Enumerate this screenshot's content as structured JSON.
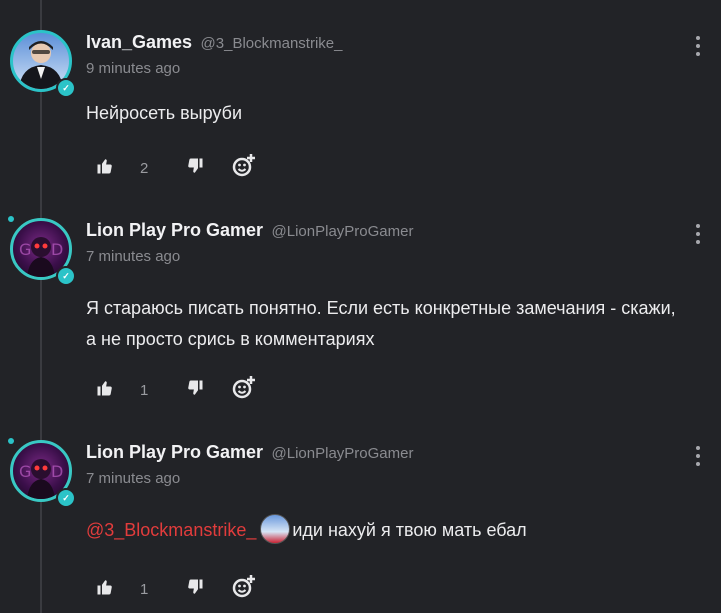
{
  "comments": [
    {
      "username": "Ivan_Games",
      "handle": "@3_Blockmanstrike_",
      "time": "9 minutes ago",
      "text": "Нейросеть выруби",
      "likes": "2",
      "avatar_icon": "user-avatar-icon"
    },
    {
      "username": "Lion Play Pro Gamer",
      "handle": "@LionPlayProGamer",
      "time": "7 minutes ago",
      "text_line1": "Я стараюсь писать понятно. Если есть конкретные замечания - скажи,",
      "text_line2": "а не просто срись в комментариях",
      "likes": "1",
      "avatar_icon": "user-avatar-icon"
    },
    {
      "username": "Lion Play Pro Gamer",
      "handle": "@LionPlayProGamer",
      "time": "7 minutes ago",
      "mention": "@3_Blockmanstrike_",
      "text": "иди нахуй я твою мать ебал",
      "likes": "1",
      "avatar_icon": "user-avatar-icon"
    }
  ],
  "colors": {
    "background": "#222327",
    "accent": "#2bc3c8",
    "mention": "#e23c3c"
  }
}
